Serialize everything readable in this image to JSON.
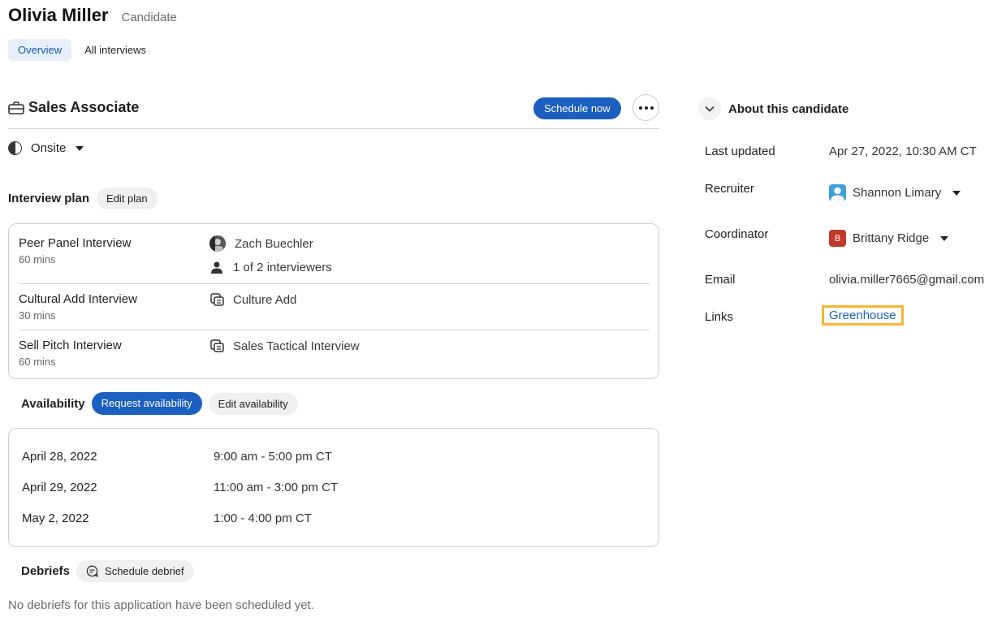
{
  "candidate": {
    "name": "Olivia Miller",
    "role": "Candidate"
  },
  "tabs": [
    {
      "label": "Overview"
    },
    {
      "label": "All interviews"
    }
  ],
  "job": {
    "title": "Sales Associate",
    "schedule_label": "Schedule now",
    "stage": "Onsite"
  },
  "plan": {
    "label": "Interview plan",
    "edit_label": "Edit plan",
    "interviews": [
      {
        "name": "Peer Panel Interview",
        "duration": "60 mins",
        "interviewer": "Zach Buechler",
        "count": "1 of 2 interviewers"
      },
      {
        "name": "Cultural Add Interview",
        "duration": "30 mins",
        "detail": "Culture Add"
      },
      {
        "name": "Sell Pitch Interview",
        "duration": "60 mins",
        "detail": "Sales Tactical Interview"
      }
    ]
  },
  "availability": {
    "label": "Availability",
    "request_label": "Request availability",
    "edit_label": "Edit availability",
    "slots": [
      {
        "date": "April 28, 2022",
        "time": "9:00 am - 5:00 pm CT"
      },
      {
        "date": "April 29, 2022",
        "time": "11:00 am - 3:00 pm CT"
      },
      {
        "date": "May 2, 2022",
        "time": "1:00 - 4:00 pm CT"
      }
    ]
  },
  "debriefs": {
    "label": "Debriefs",
    "schedule_label": "Schedule debrief",
    "empty": "No debriefs for this application have been scheduled yet."
  },
  "about": {
    "title": "About this candidate",
    "last_updated_label": "Last updated",
    "last_updated": "Apr 27, 2022, 10:30 AM CT",
    "recruiter_label": "Recruiter",
    "recruiter": "Shannon Limary",
    "coordinator_label": "Coordinator",
    "coordinator": "Brittany Ridge",
    "coordinator_initial": "B",
    "email_label": "Email",
    "email": "olivia.miller7665@gmail.com",
    "links_label": "Links",
    "link": "Greenhouse"
  },
  "colors": {
    "accent": "#1b5fc0",
    "highlight": "#f5b635",
    "coordinator_avatar": "#c0392b",
    "recruiter_avatar": "#3aa0d8"
  }
}
